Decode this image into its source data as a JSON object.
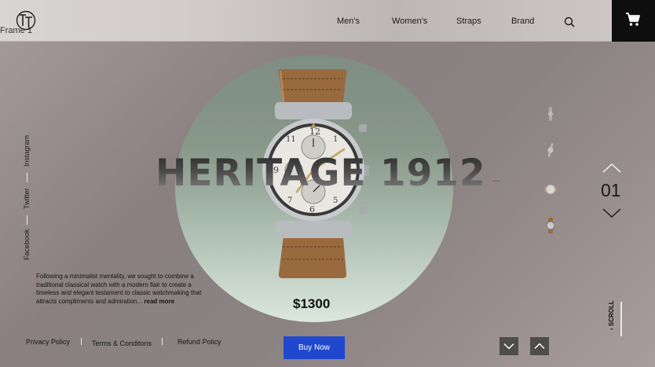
{
  "frame_label": "Frame 1",
  "header": {
    "logo_icon": "tt-monogram-logo",
    "nav": [
      {
        "label": "Men's"
      },
      {
        "label": "Women's"
      },
      {
        "label": "Straps"
      },
      {
        "label": "Brand"
      }
    ],
    "search_icon": "search-icon",
    "cart_icon": "cart-icon"
  },
  "hero": {
    "title": "HERITAGE 1912",
    "ellipsis": "...",
    "price": "$1300",
    "buy_label": "Buy Now"
  },
  "social": [
    {
      "label": "Instagram"
    },
    {
      "label": "Twitter"
    },
    {
      "label": "Facebook"
    }
  ],
  "description": {
    "text": "Following a minimalist mentality, we sought to combine a traditional classical watch with a modern flair to create a timeless and elegant testament to classic watchmaking that attracts compliments and admiration...",
    "read_more": "read more"
  },
  "footer": {
    "links": [
      {
        "label": "Privacy Policy"
      },
      {
        "label": "Terms & Conditons"
      },
      {
        "label": "Refund Policy"
      }
    ]
  },
  "slider": {
    "counter": "01",
    "scroll_label": "SCROLL"
  },
  "colors": {
    "buy_button": "#2048cf",
    "cart_bg": "#0e0e0e"
  }
}
